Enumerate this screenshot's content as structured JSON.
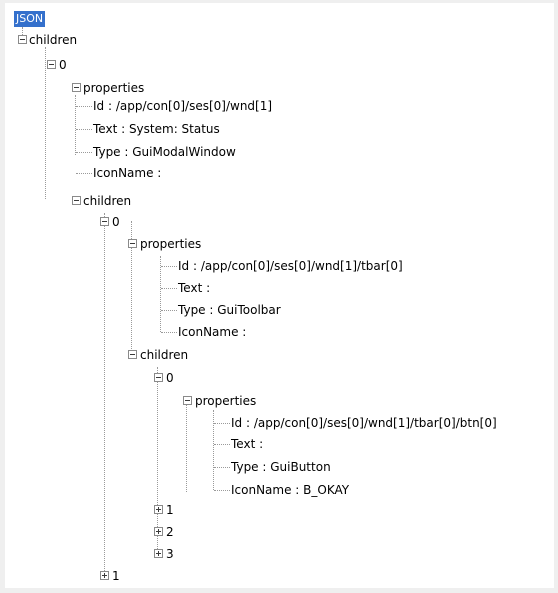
{
  "tree": {
    "root": "JSON",
    "children_label": "children",
    "properties_label": "properties",
    "n0": "0",
    "n1": "1",
    "n2": "2",
    "n3": "3",
    "wnd_id": "Id : /app/con[0]/ses[0]/wnd[1]",
    "wnd_text": "Text : System: Status",
    "wnd_type": "Type : GuiModalWindow",
    "wnd_icon": "IconName :",
    "tbar_id": "Id : /app/con[0]/ses[0]/wnd[1]/tbar[0]",
    "tbar_text": "Text :",
    "tbar_type": "Type : GuiToolbar",
    "tbar_icon": "IconName :",
    "btn_id": "Id : /app/con[0]/ses[0]/wnd[1]/tbar[0]/btn[0]",
    "btn_text": "Text :",
    "btn_type": "Type : GuiButton",
    "btn_icon": "IconName : B_OKAY"
  }
}
